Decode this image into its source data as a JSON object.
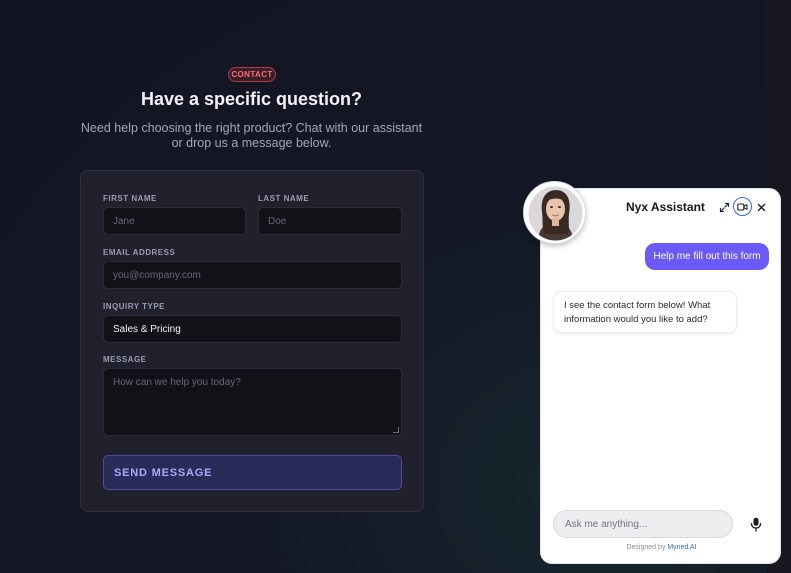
{
  "header": {
    "badge": "CONTACT",
    "title": "Have a specific question?",
    "subtitle": "Need help choosing the right product? Chat with our assistant or drop us a message below."
  },
  "form": {
    "first_name": {
      "label": "FIRST NAME",
      "placeholder": "Jane"
    },
    "last_name": {
      "label": "LAST NAME",
      "placeholder": "Doe"
    },
    "email": {
      "label": "EMAIL ADDRESS",
      "placeholder": "you@company.com"
    },
    "inquiry": {
      "label": "INQUIRY TYPE",
      "value": "Sales & Pricing"
    },
    "message": {
      "label": "MESSAGE",
      "placeholder": "How can we help you today?"
    },
    "submit_label": "SEND MESSAGE"
  },
  "chat": {
    "title": "Nyx Assistant",
    "user_message": "Help me fill out this form",
    "bot_message": "I see the contact form below! What information would you like to add?",
    "input_placeholder": "Ask me anything...",
    "footer_prefix": "Designed by",
    "footer_brand": "Myned AI",
    "icons": [
      "expand-icon",
      "video-icon",
      "close-icon",
      "microphone-icon"
    ]
  },
  "colors": {
    "accent": "#6a5af9",
    "badge": "#ff6b74",
    "link": "#3a67d8"
  }
}
